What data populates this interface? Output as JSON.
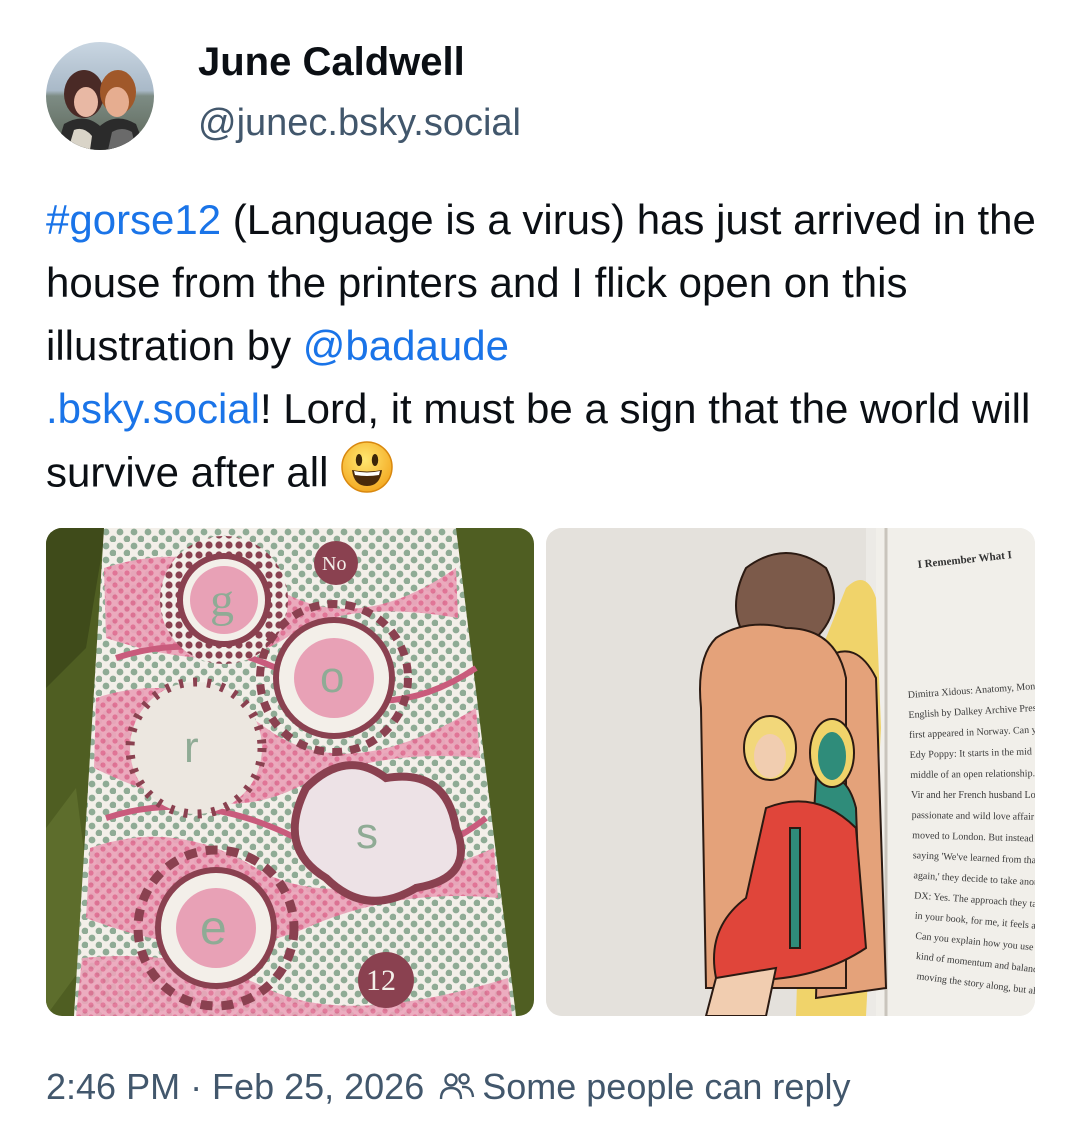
{
  "author": {
    "name": "June Caldwell",
    "handle": "@junec.bsky.social"
  },
  "post": {
    "hashtag": "#gorse12",
    "text_1": " (Language is a virus) has just arrived in the house from the printers and I flick open on this illustration by ",
    "mention_1": "@badaude",
    "mention_2": ".bsky.social",
    "text_2": "! Lord, it must be a sign that the world will survive after all ",
    "emoji": "grinning-face"
  },
  "images": [
    {
      "alt_kind": "book-cover",
      "cover_letters": [
        "g",
        "o",
        "r",
        "s",
        "e"
      ],
      "cover_no": "No",
      "cover_number": "12"
    },
    {
      "alt_kind": "book-spread-illustration",
      "page_heading": "I Remember What I",
      "page_lines": [
        "Dimitra Xidous: Anatomy, Monst",
        "English by Dalkey Archive Press, more",
        "first appeared in Norway. Can you tell",
        "Edy Poppy: It starts in the mid",
        "middle of an open relationship. Th",
        "Vir and her French husband Lou hav",
        "passionate and wild love affair in the S",
        "moved to London. But instead of Vi",
        "saying 'We've learned from that exper",
        "again,' they decide to take another appr",
        "DX: Yes. The approach they take,",
        "in your book, for me, it feels as if it is",
        "Can you explain how you use memory",
        "kind of momentum and balance—it'",
        "moving the story along, but al"
      ]
    }
  ],
  "footer": {
    "timestamp": "2:46 PM · Feb 25, 2026",
    "reply_setting": "Some people can reply"
  },
  "colors": {
    "link": "#1a74e8",
    "secondary_text": "#42576c",
    "cover_pink": "#e58aa6",
    "cover_maroon": "#8a4150",
    "cover_green": "#8fab95"
  }
}
